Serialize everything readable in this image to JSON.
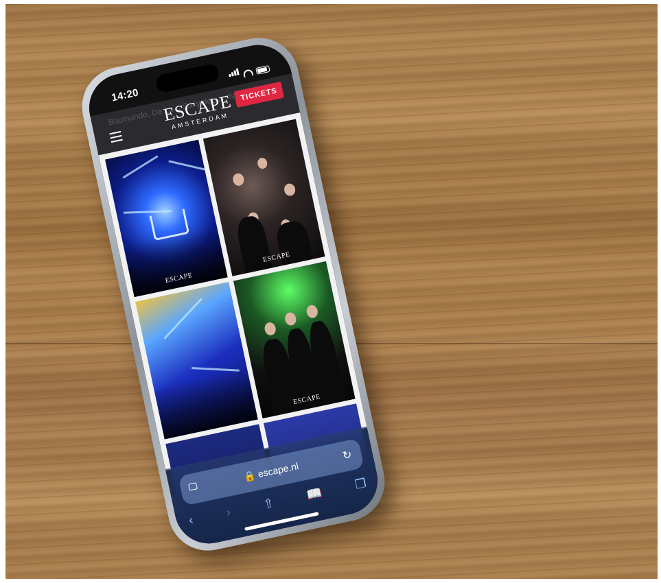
{
  "status_bar": {
    "time": "14:20"
  },
  "site": {
    "background_text": "Baumundo, De Lo... Saxy deLux, Nesh",
    "logo": {
      "name": "ESCAPE",
      "city": "AMSTERDAM"
    },
    "tickets_label": "TICKETS",
    "menu_icon": "hamburger-icon"
  },
  "gallery": {
    "photos": [
      {
        "scene": "stage-crown-blue-lights",
        "watermark": "ESCAPE"
      },
      {
        "scene": "dancing-crowd",
        "watermark": "ESCAPE"
      },
      {
        "scene": "dj-stage-smoke",
        "watermark": ""
      },
      {
        "scene": "group-of-women-green-lights",
        "watermark": "ESCAPE"
      },
      {
        "scene": "partial-photo",
        "watermark": ""
      },
      {
        "scene": "partial-photo",
        "watermark": ""
      }
    ]
  },
  "browser": {
    "url": "escape.nl",
    "lock_icon": "lock-icon",
    "toolbar_icons": [
      "back-icon",
      "forward-icon",
      "share-icon",
      "bookmarks-icon",
      "tabs-icon"
    ]
  },
  "colors": {
    "tickets_button": "#e02742",
    "header_bg": "#2b2b2f",
    "wood": "#a77c4c"
  }
}
